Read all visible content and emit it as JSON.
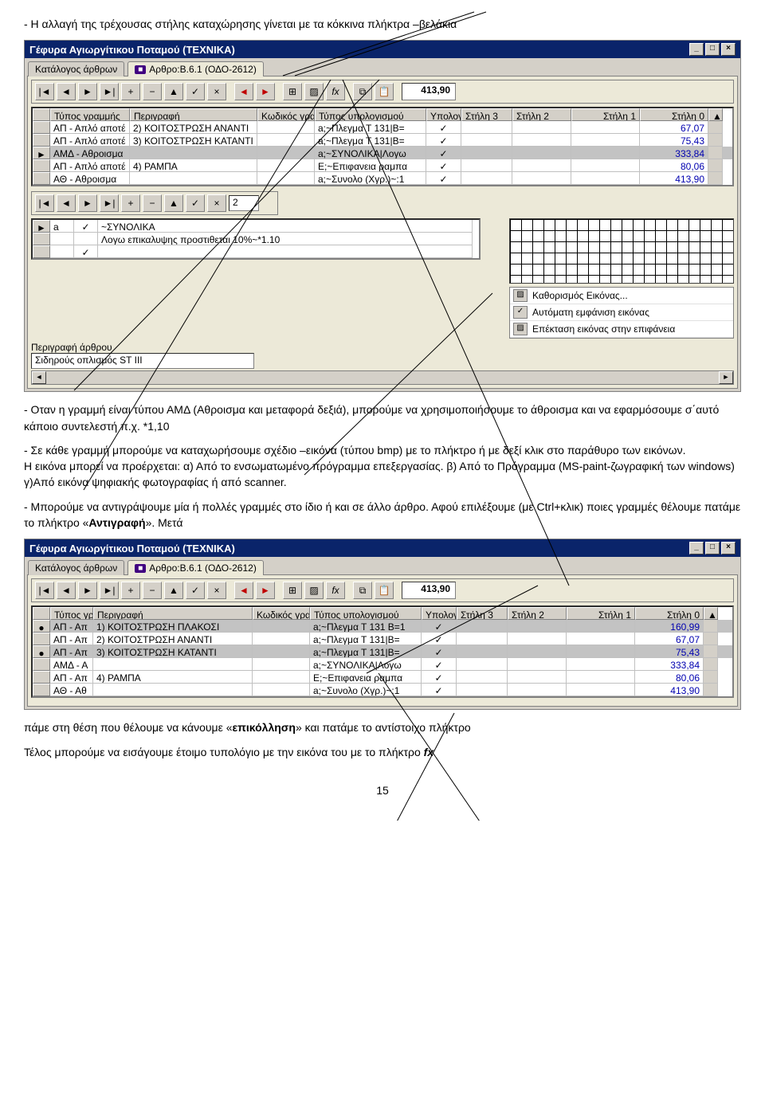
{
  "doc": {
    "bullet1": "- Η αλλαγή της τρέχουσας στήλης καταχώρησης γίνεται με τα κόκκινα πλήκτρα –βελάκια",
    "bullet2_a": "- Οταν η γραμμή είναι τύπου ΑΜΔ (Αθροισμα και μεταφορά δεξιά), μπορούμε να χρησιμοποιήσουμε το άθροισμα και να εφαρμόσουμε σ΄αυτό κάποιο συντελεστή π.χ. *1,10",
    "bullet3_a": "- Σε κάθε γραμμή μπορούμε να καταχωρήσουμε σχέδιο –εικόνα (τύπου bmp) με το πλήκτρο ή με δεξί κλικ στο παράθυρο των εικόνων.",
    "bullet3_b": "Η εικόνα μπορεί να προέρχεται: α) Από το ενσωματωμένο πρόγραμμα επεξεργασίας. β) Από το Πρόγραμμα (MS-paint-ζωγραφική των windows) γ)Από εικόνα ψηφιακής φωτογραφίας ή από scanner.",
    "bullet4_a": "- Μπορούμε να αντιγράψουμε  μία ή πολλές γραμμές στο ίδιο ή και σε άλλο άρθρο. Αφού επιλέξουμε (με Ctrl+κλικ) ποιες γραμμές θέλουμε πατάμε το πλήκτρο «",
    "bullet4_bold1": "Αντιγραφή",
    "bullet4_mid": "».  Μετά",
    "aftertext_a": "πάμε στη θέση που θέλουμε να κάνουμε «",
    "aftertext_bold": "επικόλληση",
    "aftertext_b": "» και πατάμε το αντίστοιχο πλήκτρο",
    "finaltext_a": "Τέλος μπορούμε να εισάγουμε  έτοιμο τυπολόγιο με την εικόνα του με το πλήκτρο ",
    "finaltext_italic": "fx"
  },
  "win1": {
    "title": "Γέφυρα Αγιωργίτικου Ποταμού (ΤΕΧΝΙΚΑ)",
    "tabs": {
      "cat": "Κατάλογος άρθρων",
      "art": "Αρθρο:Β.6.1  (ΟΔΟ-2612)"
    },
    "displayValue": "413,90",
    "headers": {
      "type": "Τύπος γραμμής",
      "desc": "Περιγραφή",
      "code": "Κωδικός γραμμής",
      "calc": "Τύπος υπολογισμού",
      "up": "Υπολογισμός",
      "s3": "Στήλη 3",
      "s2": "Στήλη 2",
      "s1": "Στήλη 1",
      "s0": "Στήλη 0"
    },
    "rows": [
      {
        "type": "ΑΠ - Απλό αποτέ",
        "desc": "2) ΚΟΙΤΟΣΤΡΩΣΗ ΑΝΑΝΤΙ",
        "code": "",
        "calc": "a;~Πλεγμα Τ 131|Β=",
        "up": "✓",
        "s0": "67,07"
      },
      {
        "type": "ΑΠ - Απλό αποτέ",
        "desc": "3) ΚΟΙΤΟΣΤΡΩΣΗ ΚΑΤΑΝΤΙ",
        "code": "",
        "calc": "a;~Πλεγμα Τ 131|Β=",
        "up": "✓",
        "s0": "75,43"
      },
      {
        "type": "ΑΜΔ - Αθροισμα",
        "desc": "",
        "code": "",
        "calc": "a;~ΣΥΝΟΛΙΚΑ|Λογω",
        "up": "✓",
        "s0": "333,84",
        "sel": true
      },
      {
        "type": "ΑΠ - Απλό αποτέ",
        "desc": "4) ΡΑΜΠΑ",
        "code": "",
        "calc": "E;~Επιφανεια ραμπα",
        "up": "✓",
        "s0": "80,06"
      },
      {
        "type": "ΑΘ - Αθροισμα",
        "desc": "",
        "code": "",
        "calc": "a;~Συνολο (Xγρ.)~:1",
        "up": "✓",
        "s0": "413,90"
      }
    ],
    "tb2value": "2",
    "lowerA": "a",
    "lowerText1": "~ΣΥΝΟΛΙΚΑ",
    "lowerText2": "Λογω επικαλυψης προστιθεται 10%~*1.10",
    "menu": {
      "m1": "Καθορισμός Εικόνας...",
      "m2": "Αυτόματη εμφάνιση εικόνας",
      "m3": "Επέκταση εικόνας στην επιφάνεια"
    },
    "lbl1": "Περιγραφή άρθρου",
    "lbl2": "Σιδηρούς οπλισμός ST III"
  },
  "win2": {
    "title": "Γέφυρα Αγιωργίτικου Ποταμού (ΤΕΧΝΙΚΑ)",
    "tabs": {
      "cat": "Κατάλογος άρθρων",
      "art": "Αρθρο:Β.6.1  (ΟΔΟ-2612)"
    },
    "displayValue": "413,90",
    "headers": {
      "type": "Τύπος γραμ",
      "desc": "Περιγραφή",
      "code": "Κωδικός γραμμής",
      "calc": "Τύπος υπολογισμού",
      "up": "Υπολογισμός",
      "s3": "Στήλη 3",
      "s2": "Στήλη 2",
      "s1": "Στήλη 1",
      "s0": "Στήλη 0"
    },
    "rows": [
      {
        "type": "ΑΠ - Απ",
        "desc": "1) ΚΟΙΤΟΣΤΡΩΣΗ ΠΛΑΚΟΣΙ",
        "code": "",
        "calc": "a;~Πλεγμα Τ 131 Β=1",
        "up": "✓",
        "s0": "160,99",
        "sel": true,
        "dot": true
      },
      {
        "type": "ΑΠ - Απ",
        "desc": "2) ΚΟΙΤΟΣΤΡΩΣΗ ΑΝΑΝΤΙ",
        "code": "",
        "calc": "a;~Πλεγμα Τ 131|Β=",
        "up": "✓",
        "s0": "67,07"
      },
      {
        "type": "ΑΠ - Απ",
        "desc": "3) ΚΟΙΤΟΣΤΡΩΣΗ ΚΑΤΑΝΤΙ",
        "code": "",
        "calc": "a;~Πλεγμα Τ 131|Β=",
        "up": "✓",
        "s0": "75,43",
        "sel": true,
        "dot": true
      },
      {
        "type": "ΑΜΔ - Α",
        "desc": "",
        "code": "",
        "calc": "a;~ΣΥΝΟΛΙΚΑ|Λογω",
        "up": "✓",
        "s0": "333,84"
      },
      {
        "type": "ΑΠ - Απ",
        "desc": "4) ΡΑΜΠΑ",
        "code": "",
        "calc": "E;~Επιφανεια ραμπα",
        "up": "✓",
        "s0": "80,06"
      },
      {
        "type": "ΑΘ - Αθ",
        "desc": "",
        "code": "",
        "calc": "a;~Συνολο (Xγρ.)~:1",
        "up": "✓",
        "s0": "413,90"
      }
    ]
  },
  "pagenum": "15"
}
